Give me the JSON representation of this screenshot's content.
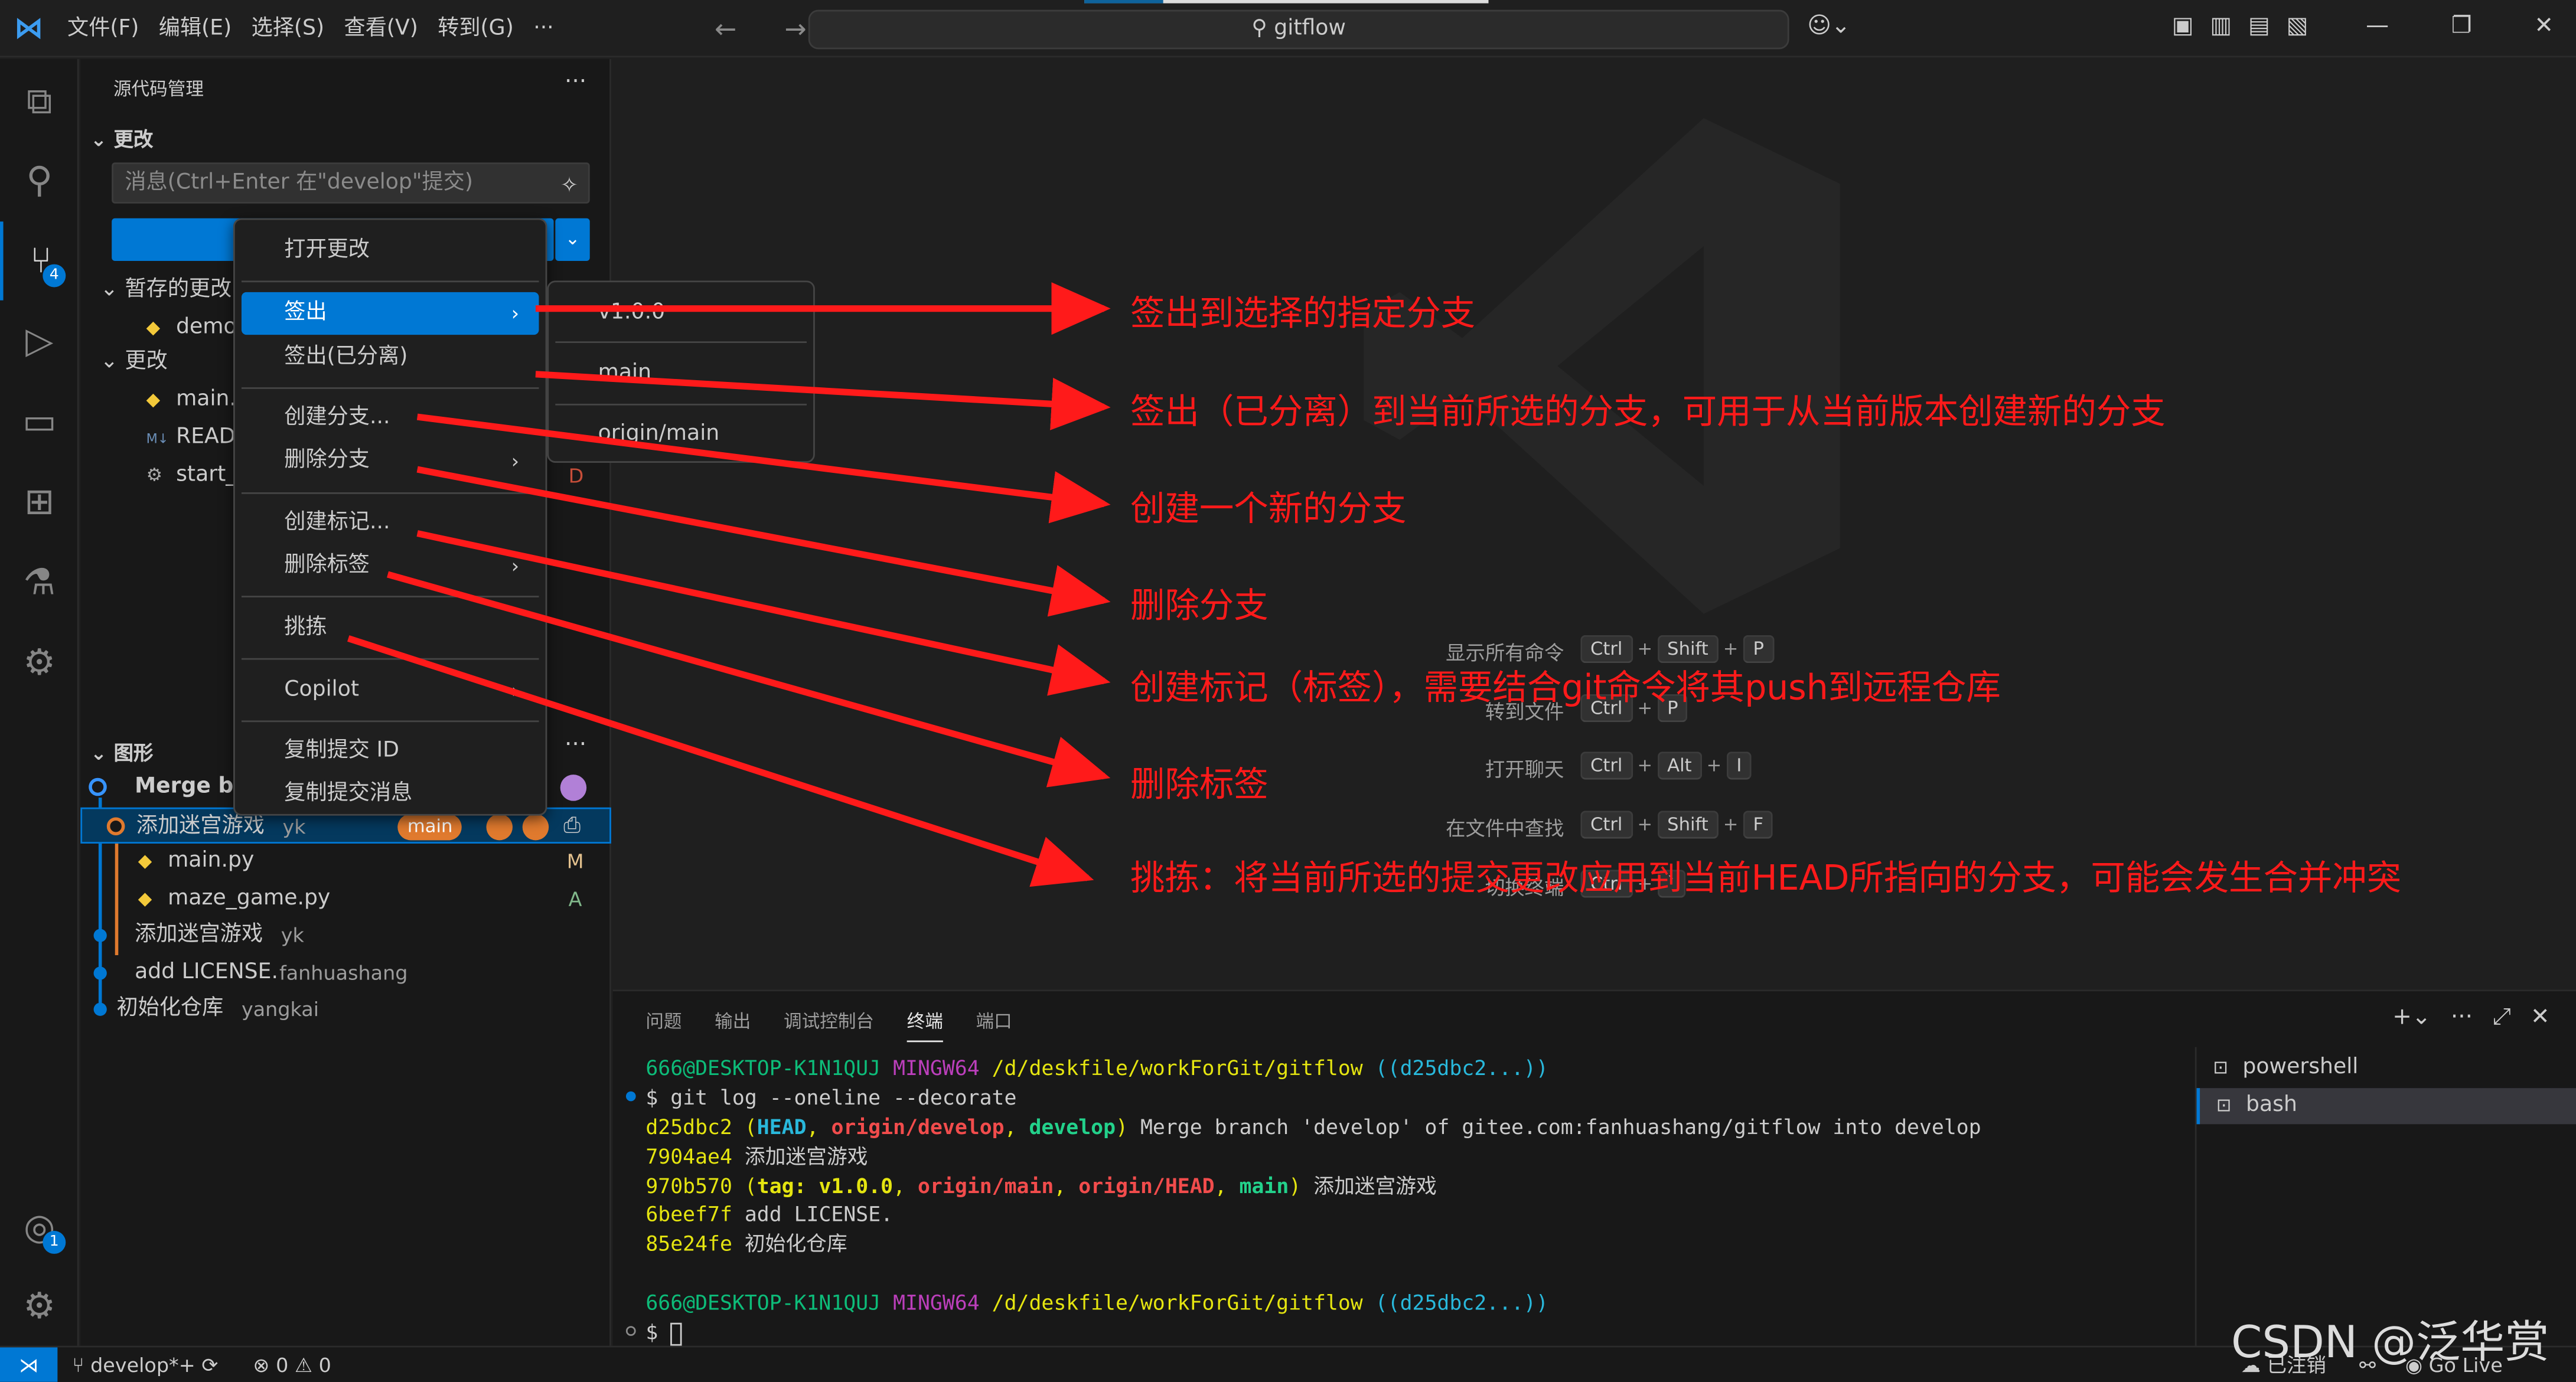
{
  "titlebar": {
    "menus": [
      "文件(F)",
      "编辑(E)",
      "选择(S)",
      "查看(V)",
      "转到(G)",
      "···"
    ],
    "search": "gitflow",
    "nav": "←  →"
  },
  "activity_badges": {
    "scm": "4",
    "accounts": "1"
  },
  "sidebar": {
    "title": "源代码管理",
    "more": "···",
    "changes_header": "更改",
    "commit_placeholder": "消息(Ctrl+Enter 在\"develop\"提交)",
    "stash_header": "暂存的更改",
    "stash_files": [
      "demo"
    ],
    "changes_subheader": "更改",
    "change_files": [
      "main.",
      "READ",
      "start_"
    ],
    "change_status": "D",
    "graph_header": "图形",
    "graph_more": "···",
    "graph": [
      {
        "message": "Merge bra",
        "author": ""
      },
      {
        "message": "添加迷宫游戏",
        "author": "yk",
        "badge": "main"
      },
      {
        "message": "main.py",
        "status": "M"
      },
      {
        "message": "maze_game.py",
        "status": "A"
      },
      {
        "message": "添加迷宫游戏",
        "author": "yk"
      },
      {
        "message": "add LICENSE.",
        "author": "fanhuashang"
      },
      {
        "message": "初始化仓库",
        "author": "yangkai"
      }
    ]
  },
  "context_menu": {
    "items": [
      "打开更改",
      "签出",
      "签出(已分离)",
      "创建分支...",
      "删除分支",
      "创建标记...",
      "删除标签",
      "挑拣",
      "Copilot",
      "复制提交 ID",
      "复制提交消息"
    ]
  },
  "submenu": {
    "items": [
      "v1.0.0",
      "main",
      "origin/main"
    ]
  },
  "shortcuts": [
    {
      "label": "显示所有命令",
      "keys": [
        "Ctrl",
        "Shift",
        "P"
      ]
    },
    {
      "label": "转到文件",
      "keys": [
        "Ctrl",
        "P"
      ]
    },
    {
      "label": "打开聊天",
      "keys": [
        "Ctrl",
        "Alt",
        "I"
      ]
    },
    {
      "label": "在文件中查找",
      "keys": [
        "Ctrl",
        "Shift",
        "F"
      ]
    },
    {
      "label": "切换终端",
      "keys": [
        "Ctrl",
        "`"
      ]
    }
  ],
  "annotations": [
    "签出到选择的指定分支",
    "签出（已分离）到当前所选的分支，可用于从当前版本创建新的分支",
    "创建一个新的分支",
    "删除分支",
    "创建标记（标签），需要结合git命令将其push到远程仓库",
    "删除标签",
    "挑拣：将当前所选的提交更改应用到当前HEAD所指向的分支，可能会发生合并冲突"
  ],
  "panel": {
    "tabs": [
      "问题",
      "输出",
      "调试控制台",
      "终端",
      "端口"
    ],
    "terminal": {
      "prompt_user": "666@DESKTOP-K1N1QUJ",
      "prompt_env": "MINGW64",
      "prompt_path": "/d/deskfile/workForGit/gitflow",
      "prompt_branch": "((d25dbc2...))",
      "command": "$ git log --oneline --decorate",
      "log": [
        {
          "hash": "d25dbc2",
          "refs": "(HEAD, origin/develop, develop)",
          "msg": "Merge branch 'develop' of gitee.com:fanhuashang/gitflow into develop"
        },
        {
          "hash": "7904ae4",
          "refs": "",
          "msg": "添加迷宫游戏"
        },
        {
          "hash": "970b570",
          "refs": "(tag: v1.0.0, origin/main, origin/HEAD, main)",
          "msg": "添加迷宫游戏"
        },
        {
          "hash": "6beef7f",
          "refs": "",
          "msg": "add LICENSE."
        },
        {
          "hash": "85e24fe",
          "refs": "",
          "msg": "初始化仓库"
        }
      ],
      "last_prompt": "$ "
    },
    "term_list": [
      "powershell",
      "bash"
    ]
  },
  "statusbar": {
    "branch": "develop*+",
    "errors": "0",
    "warnings": "0",
    "signout": "已注销",
    "golive": "Go Live"
  },
  "watermark_text": "CSDN @泛华赏"
}
